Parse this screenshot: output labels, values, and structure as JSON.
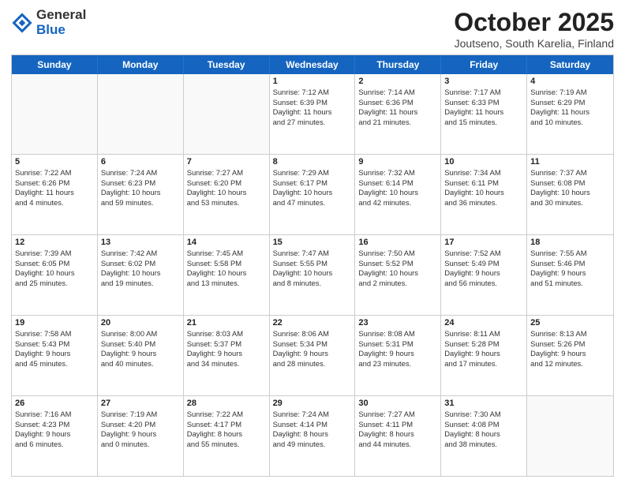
{
  "header": {
    "logo_general": "General",
    "logo_blue": "Blue",
    "title": "October 2025",
    "subtitle": "Joutseno, South Karelia, Finland"
  },
  "weekdays": [
    "Sunday",
    "Monday",
    "Tuesday",
    "Wednesday",
    "Thursday",
    "Friday",
    "Saturday"
  ],
  "weeks": [
    [
      {
        "day": "",
        "lines": []
      },
      {
        "day": "",
        "lines": []
      },
      {
        "day": "",
        "lines": []
      },
      {
        "day": "1",
        "lines": [
          "Sunrise: 7:12 AM",
          "Sunset: 6:39 PM",
          "Daylight: 11 hours",
          "and 27 minutes."
        ]
      },
      {
        "day": "2",
        "lines": [
          "Sunrise: 7:14 AM",
          "Sunset: 6:36 PM",
          "Daylight: 11 hours",
          "and 21 minutes."
        ]
      },
      {
        "day": "3",
        "lines": [
          "Sunrise: 7:17 AM",
          "Sunset: 6:33 PM",
          "Daylight: 11 hours",
          "and 15 minutes."
        ]
      },
      {
        "day": "4",
        "lines": [
          "Sunrise: 7:19 AM",
          "Sunset: 6:29 PM",
          "Daylight: 11 hours",
          "and 10 minutes."
        ]
      }
    ],
    [
      {
        "day": "5",
        "lines": [
          "Sunrise: 7:22 AM",
          "Sunset: 6:26 PM",
          "Daylight: 11 hours",
          "and 4 minutes."
        ]
      },
      {
        "day": "6",
        "lines": [
          "Sunrise: 7:24 AM",
          "Sunset: 6:23 PM",
          "Daylight: 10 hours",
          "and 59 minutes."
        ]
      },
      {
        "day": "7",
        "lines": [
          "Sunrise: 7:27 AM",
          "Sunset: 6:20 PM",
          "Daylight: 10 hours",
          "and 53 minutes."
        ]
      },
      {
        "day": "8",
        "lines": [
          "Sunrise: 7:29 AM",
          "Sunset: 6:17 PM",
          "Daylight: 10 hours",
          "and 47 minutes."
        ]
      },
      {
        "day": "9",
        "lines": [
          "Sunrise: 7:32 AM",
          "Sunset: 6:14 PM",
          "Daylight: 10 hours",
          "and 42 minutes."
        ]
      },
      {
        "day": "10",
        "lines": [
          "Sunrise: 7:34 AM",
          "Sunset: 6:11 PM",
          "Daylight: 10 hours",
          "and 36 minutes."
        ]
      },
      {
        "day": "11",
        "lines": [
          "Sunrise: 7:37 AM",
          "Sunset: 6:08 PM",
          "Daylight: 10 hours",
          "and 30 minutes."
        ]
      }
    ],
    [
      {
        "day": "12",
        "lines": [
          "Sunrise: 7:39 AM",
          "Sunset: 6:05 PM",
          "Daylight: 10 hours",
          "and 25 minutes."
        ]
      },
      {
        "day": "13",
        "lines": [
          "Sunrise: 7:42 AM",
          "Sunset: 6:02 PM",
          "Daylight: 10 hours",
          "and 19 minutes."
        ]
      },
      {
        "day": "14",
        "lines": [
          "Sunrise: 7:45 AM",
          "Sunset: 5:58 PM",
          "Daylight: 10 hours",
          "and 13 minutes."
        ]
      },
      {
        "day": "15",
        "lines": [
          "Sunrise: 7:47 AM",
          "Sunset: 5:55 PM",
          "Daylight: 10 hours",
          "and 8 minutes."
        ]
      },
      {
        "day": "16",
        "lines": [
          "Sunrise: 7:50 AM",
          "Sunset: 5:52 PM",
          "Daylight: 10 hours",
          "and 2 minutes."
        ]
      },
      {
        "day": "17",
        "lines": [
          "Sunrise: 7:52 AM",
          "Sunset: 5:49 PM",
          "Daylight: 9 hours",
          "and 56 minutes."
        ]
      },
      {
        "day": "18",
        "lines": [
          "Sunrise: 7:55 AM",
          "Sunset: 5:46 PM",
          "Daylight: 9 hours",
          "and 51 minutes."
        ]
      }
    ],
    [
      {
        "day": "19",
        "lines": [
          "Sunrise: 7:58 AM",
          "Sunset: 5:43 PM",
          "Daylight: 9 hours",
          "and 45 minutes."
        ]
      },
      {
        "day": "20",
        "lines": [
          "Sunrise: 8:00 AM",
          "Sunset: 5:40 PM",
          "Daylight: 9 hours",
          "and 40 minutes."
        ]
      },
      {
        "day": "21",
        "lines": [
          "Sunrise: 8:03 AM",
          "Sunset: 5:37 PM",
          "Daylight: 9 hours",
          "and 34 minutes."
        ]
      },
      {
        "day": "22",
        "lines": [
          "Sunrise: 8:06 AM",
          "Sunset: 5:34 PM",
          "Daylight: 9 hours",
          "and 28 minutes."
        ]
      },
      {
        "day": "23",
        "lines": [
          "Sunrise: 8:08 AM",
          "Sunset: 5:31 PM",
          "Daylight: 9 hours",
          "and 23 minutes."
        ]
      },
      {
        "day": "24",
        "lines": [
          "Sunrise: 8:11 AM",
          "Sunset: 5:28 PM",
          "Daylight: 9 hours",
          "and 17 minutes."
        ]
      },
      {
        "day": "25",
        "lines": [
          "Sunrise: 8:13 AM",
          "Sunset: 5:26 PM",
          "Daylight: 9 hours",
          "and 12 minutes."
        ]
      }
    ],
    [
      {
        "day": "26",
        "lines": [
          "Sunrise: 7:16 AM",
          "Sunset: 4:23 PM",
          "Daylight: 9 hours",
          "and 6 minutes."
        ]
      },
      {
        "day": "27",
        "lines": [
          "Sunrise: 7:19 AM",
          "Sunset: 4:20 PM",
          "Daylight: 9 hours",
          "and 0 minutes."
        ]
      },
      {
        "day": "28",
        "lines": [
          "Sunrise: 7:22 AM",
          "Sunset: 4:17 PM",
          "Daylight: 8 hours",
          "and 55 minutes."
        ]
      },
      {
        "day": "29",
        "lines": [
          "Sunrise: 7:24 AM",
          "Sunset: 4:14 PM",
          "Daylight: 8 hours",
          "and 49 minutes."
        ]
      },
      {
        "day": "30",
        "lines": [
          "Sunrise: 7:27 AM",
          "Sunset: 4:11 PM",
          "Daylight: 8 hours",
          "and 44 minutes."
        ]
      },
      {
        "day": "31",
        "lines": [
          "Sunrise: 7:30 AM",
          "Sunset: 4:08 PM",
          "Daylight: 8 hours",
          "and 38 minutes."
        ]
      },
      {
        "day": "",
        "lines": []
      }
    ]
  ]
}
